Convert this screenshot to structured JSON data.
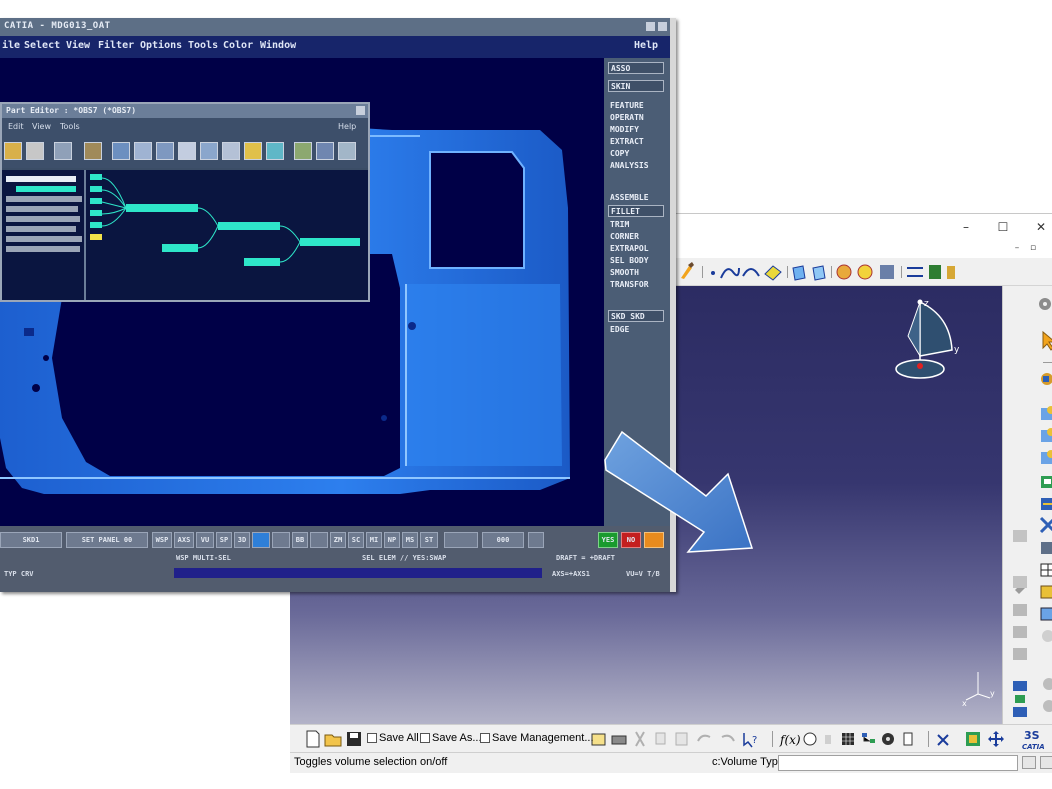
{
  "new_window": {
    "controls": {
      "minimize": "–",
      "maximize": "☐",
      "close": "✕"
    },
    "bottom_toolbar": {
      "save_all": "Save All",
      "save_as": "Save As...",
      "save_management": "Save Management..."
    },
    "status": {
      "message": "Toggles volume selection on/off",
      "command_prompt": "c:Volume Type",
      "command_value": ""
    },
    "compass": {
      "z_label": "z",
      "y_label": "y"
    },
    "axis_gizmo": {
      "y_label": "y",
      "x_label": "x"
    },
    "brand_mark": "CATIA",
    "colors": {
      "viewport_top": "#2c2c63",
      "viewport_bottom": "#b3b3c8",
      "panel": "#f0f0f0"
    }
  },
  "old_window": {
    "title": "CATIA - MDG013_OAT",
    "menus": [
      "ile",
      "Select",
      "View",
      "Filter",
      "Options",
      "Tools",
      "Color",
      "Window",
      "Help"
    ],
    "right_panel": {
      "top_boxes": [
        "ASSO",
        "SKIN"
      ],
      "group1": [
        "FEATURE",
        "OPERATN",
        "MODIFY",
        "EXTRACT",
        "COPY",
        "ANALYSIS"
      ],
      "group2": [
        "ASSEMBLE",
        "FILLET",
        "TRIM",
        "CORNER",
        "EXTRAPOL",
        "SEL BODY",
        "SMOOTH",
        "TRANSFOR"
      ],
      "group3": [
        "SKD SKD",
        "EDGE"
      ]
    },
    "part_editor": {
      "title": "Part Editor : *OBS7 (*OBS7)",
      "menu": [
        "Edit",
        "View",
        "Tools"
      ],
      "help": "Help"
    },
    "bottom_bar": {
      "buttons": [
        "SKD1",
        "SET PANEL 00",
        "WSP",
        "AXS",
        "VU",
        "SP",
        "3D",
        "BB",
        "ZM",
        "SC",
        "MI",
        "NP",
        "MS",
        "ST"
      ],
      "counter": "000",
      "yes": "YES",
      "no": "NO",
      "line2_left": "WSP MULTI-SEL",
      "line2_mid": "SEL ELEM // YES:SWAP",
      "line2_right": "DRAFT = +DRAFT",
      "line3_left": "TYP   CRV",
      "line3_mid": "AXS=+AXS1",
      "line3_right": "VU=V T/B"
    },
    "colors": {
      "background": "#000047",
      "car_body": "#2a79e8",
      "panel": "#4b5d75"
    }
  }
}
